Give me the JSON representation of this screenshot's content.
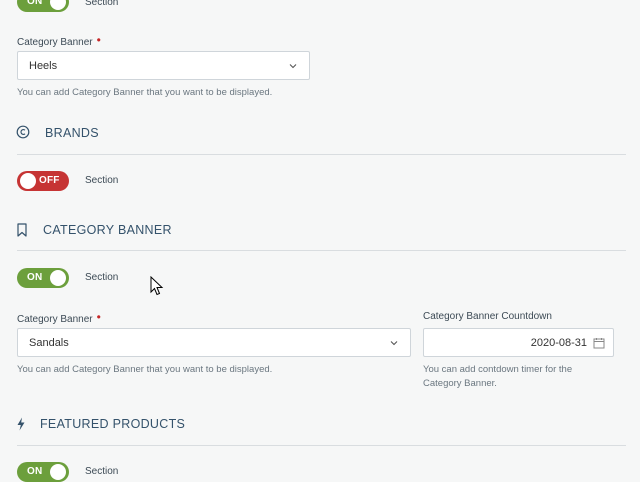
{
  "home_banner": {
    "toggle_label": "ON",
    "section_label": "Section",
    "field_label": "Category Banner",
    "selected": "Heels",
    "help": "You can add Category Banner that you want to be displayed."
  },
  "brands": {
    "heading": "BRANDS",
    "toggle_label": "OFF",
    "section_label": "Section"
  },
  "category_banner": {
    "heading": "CATEGORY BANNER",
    "toggle_label": "ON",
    "section_label": "Section",
    "field_label": "Category Banner",
    "selected": "Sandals",
    "help": "You can add Category Banner that you want to be displayed.",
    "countdown_label": "Category Banner Countdown",
    "countdown_value": "2020-08-31",
    "countdown_help_1": "You can add contdown timer for the",
    "countdown_help_2": "Category Banner."
  },
  "featured_products": {
    "heading": "FEATURED PRODUCTS",
    "toggle_label": "ON",
    "section_label": "Section"
  },
  "colors": {
    "on": "#6c9f3c",
    "off": "#c63434",
    "heading": "#34526b",
    "required": "#c62828"
  },
  "icons": {
    "brands": "copyright-icon",
    "category_banner": "bookmark-icon",
    "featured_products": "bolt-icon"
  }
}
